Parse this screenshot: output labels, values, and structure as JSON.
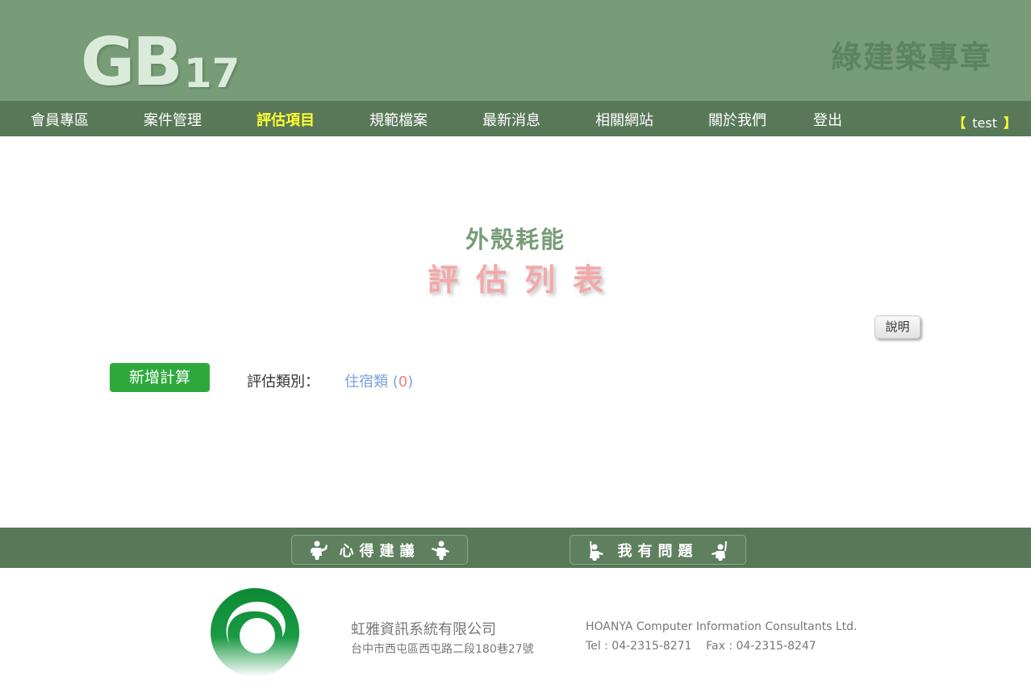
{
  "header": {
    "logo_main": "GB",
    "logo_sub": "17",
    "site_title": "綠建築專章"
  },
  "nav": {
    "items": [
      {
        "label": "會員專區"
      },
      {
        "label": "案件管理"
      },
      {
        "label": "評估項目",
        "active": true
      },
      {
        "label": "規範檔案"
      },
      {
        "label": "最新消息"
      },
      {
        "label": "相關網站"
      },
      {
        "label": "關於我們"
      },
      {
        "label": "登出"
      }
    ],
    "user": {
      "bracket_open": "【",
      "username": "test",
      "bracket_close": "】"
    }
  },
  "main": {
    "subtitle": "外殼耗能",
    "title": "評估列表",
    "help_label": "說明",
    "add_label": "新增計算",
    "category_label": "評估類別：",
    "category_name": "住宿類",
    "category_paren_open": "(",
    "category_count": "0",
    "category_paren_close": ")"
  },
  "footer_bar": {
    "feedback_label": "心得建議",
    "question_label": "我有問題"
  },
  "company": {
    "cn_name": "虹雅資訊系統有限公司",
    "cn_address": "台中市西屯區西屯路二段180巷27號",
    "en_name": "HOANYA Computer Information Consultants Ltd.",
    "contact": "Tel : 04-2315-8271    Fax : 04-2315-8247"
  },
  "colors": {
    "header_bg": "#789c78",
    "nav_bg": "#587858",
    "active_nav": "#ffff33",
    "add_button": "#2eaa3c",
    "title_pink": "#f4a8a8",
    "link_blue": "#7aa0d8"
  },
  "icons": [
    "person-thumbs-up-icon",
    "person-pointing-icon",
    "person-raise-hand-icon",
    "company-logo"
  ]
}
